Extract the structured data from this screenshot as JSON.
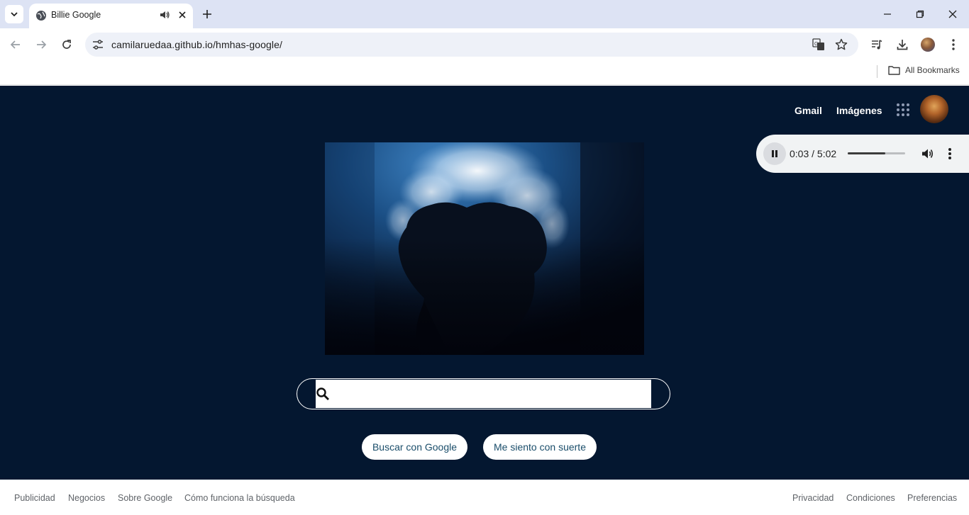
{
  "tab": {
    "title": "Billie Google"
  },
  "address_bar": {
    "url": "camilaruedaa.github.io/hmhas-google/"
  },
  "bookmarks_bar": {
    "all_bookmarks_label": "All Bookmarks"
  },
  "header": {
    "gmail_label": "Gmail",
    "images_label": "Imágenes"
  },
  "audio_player": {
    "time_text": "0:03 / 5:02",
    "volume_level": 0.65
  },
  "search": {
    "value": ""
  },
  "buttons": {
    "search_label": "Buscar con Google",
    "lucky_label": "Me siento con suerte"
  },
  "footer": {
    "left": [
      "Publicidad",
      "Negocios",
      "Sobre Google",
      "Cómo funciona la búsqueda"
    ],
    "right": [
      "Privacidad",
      "Condiciones",
      "Preferencias"
    ]
  },
  "colors": {
    "page_background": "#041730",
    "tab_strip": "#dde3f4",
    "button_text": "#1a4d6a"
  }
}
